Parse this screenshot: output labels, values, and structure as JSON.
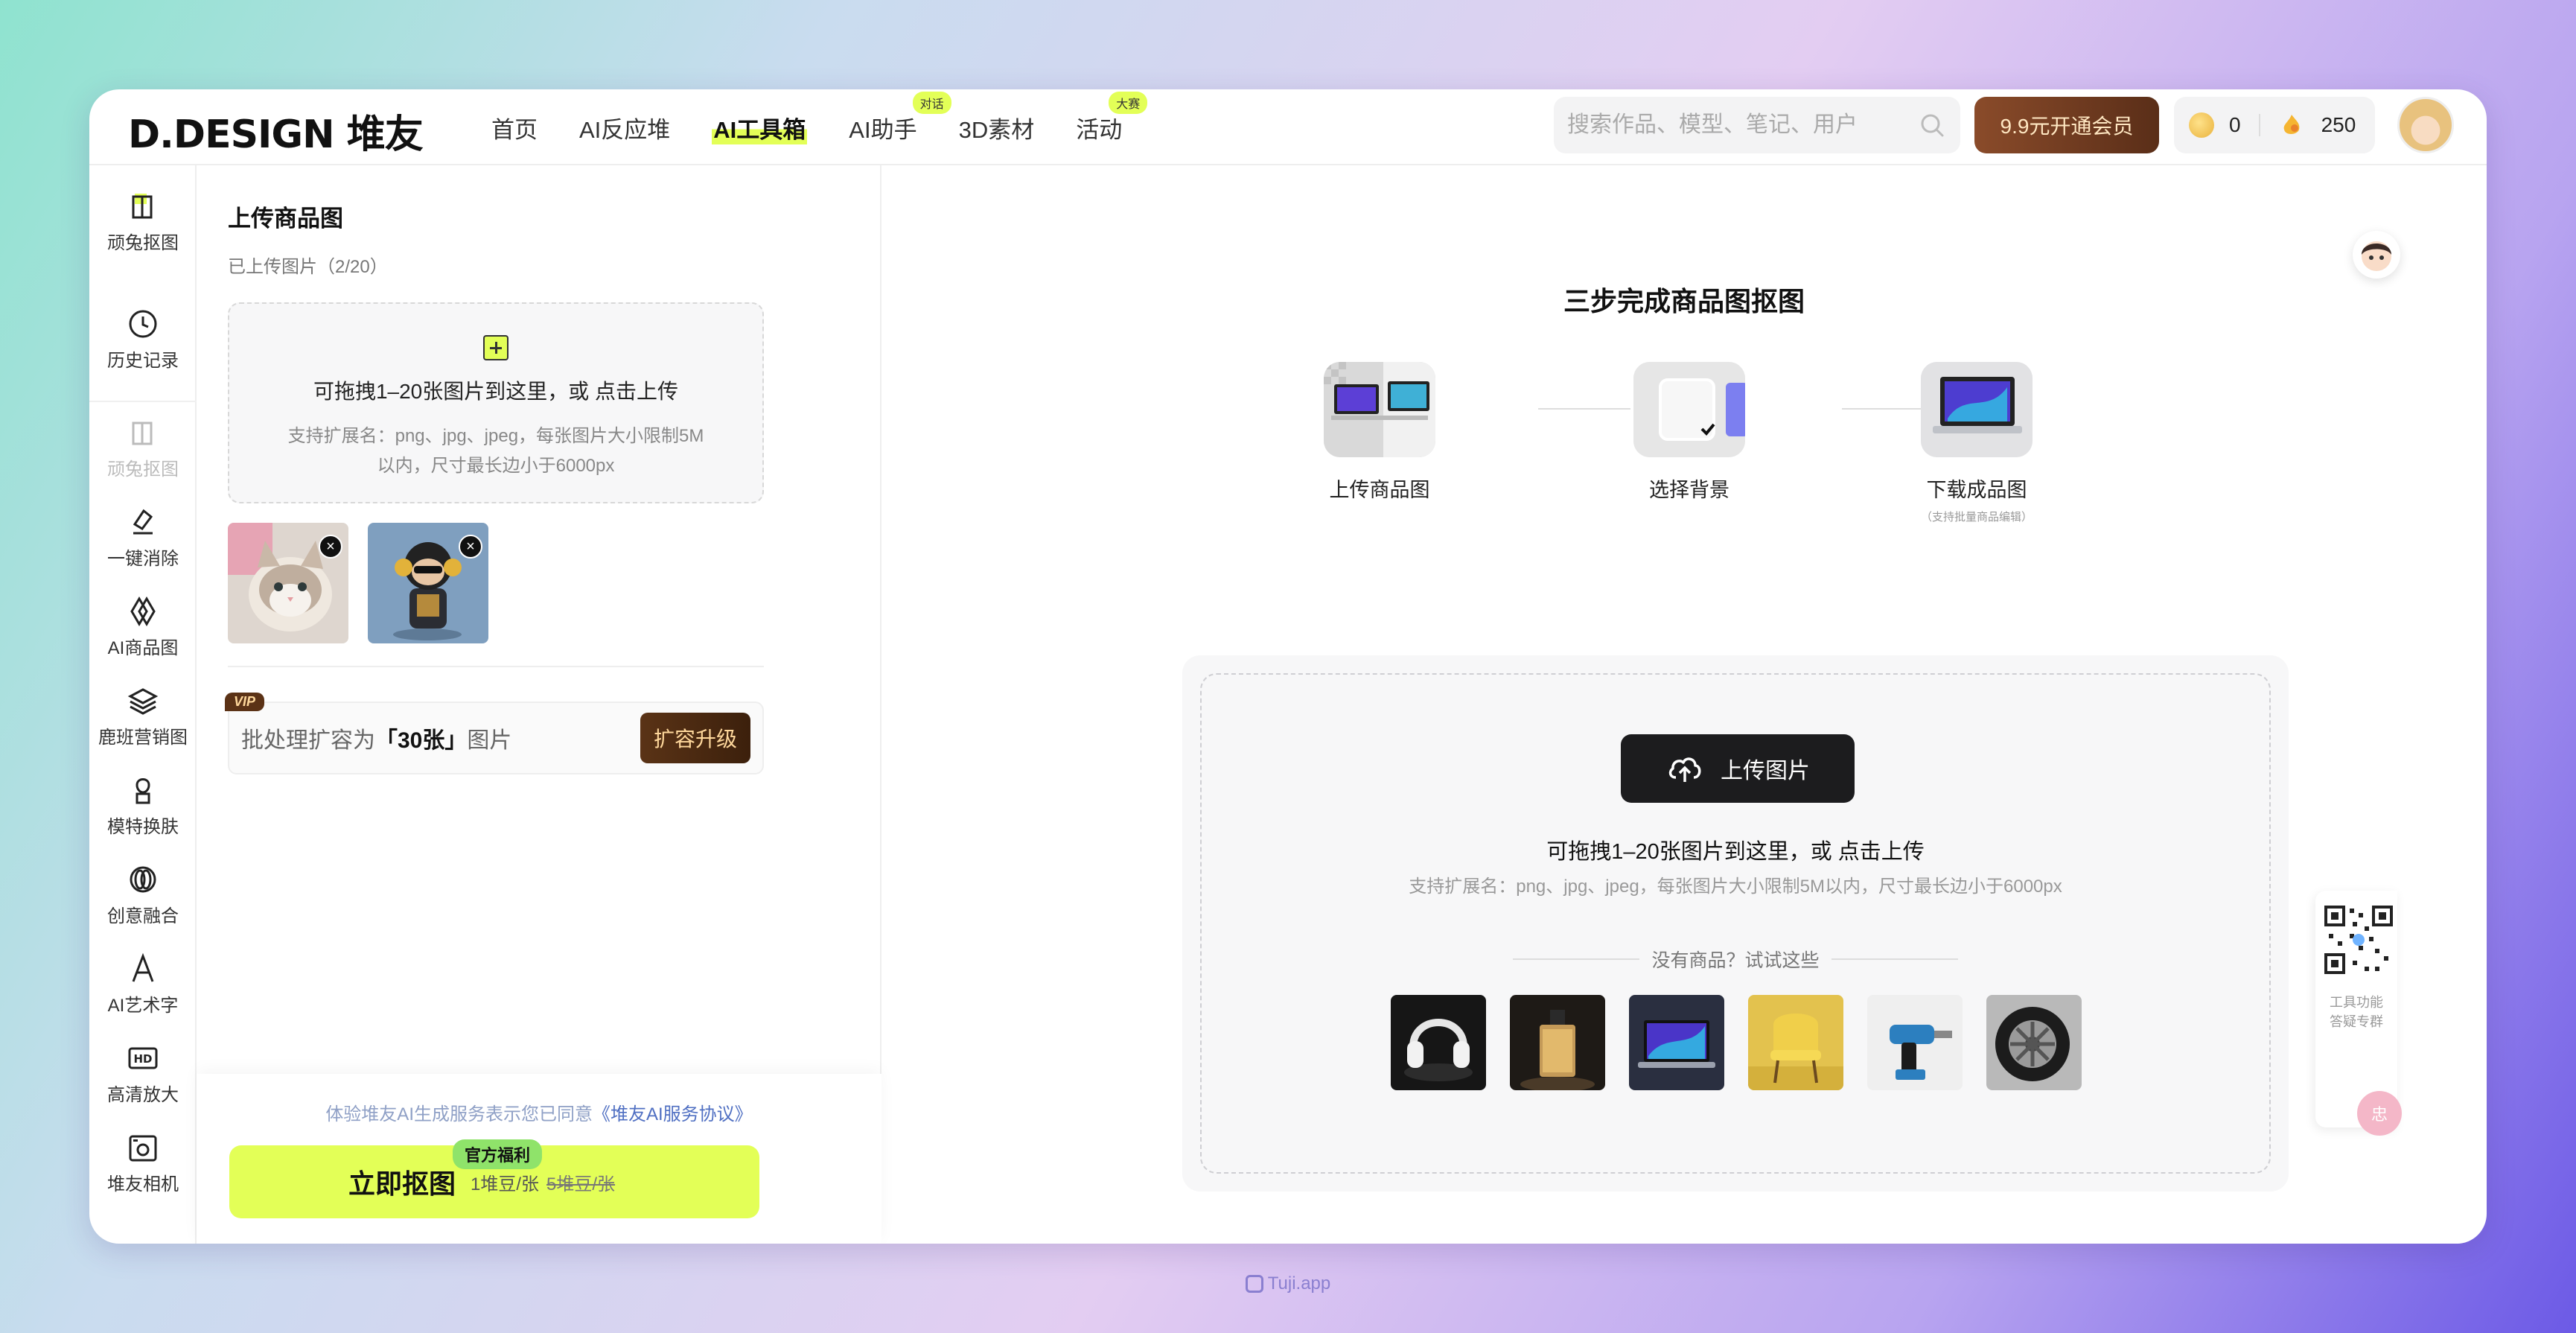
{
  "brand": {
    "logo": "D.DESIGN 堆友"
  },
  "nav": {
    "items": [
      {
        "label": "首页"
      },
      {
        "label": "AI反应堆"
      },
      {
        "label": "AI工具箱"
      },
      {
        "label": "AI助手",
        "badge": "对话"
      },
      {
        "label": "3D素材"
      },
      {
        "label": "活动",
        "badge": "大赛"
      }
    ],
    "search_placeholder": "搜索作品、模型、笔记、用户",
    "vip_button": "9.9元开通会员",
    "coins": "0",
    "beans": "250"
  },
  "rail": {
    "items": [
      {
        "label": "顽兔抠图",
        "icon": "cutout-icon"
      },
      {
        "label": "历史记录",
        "icon": "clock-icon"
      },
      {
        "label": "顽兔抠图",
        "icon": "cutout-icon"
      },
      {
        "label": "一键消除",
        "icon": "eraser-icon"
      },
      {
        "label": "AI商品图",
        "icon": "ai-product-icon"
      },
      {
        "label": "鹿班营销图",
        "icon": "layers-icon"
      },
      {
        "label": "模特换肤",
        "icon": "model-icon"
      },
      {
        "label": "创意融合",
        "icon": "fusion-icon"
      },
      {
        "label": "AI艺术字",
        "icon": "art-text-icon"
      },
      {
        "label": "高清放大",
        "icon": "hd-icon"
      },
      {
        "label": "堆友相机",
        "icon": "camera-icon"
      }
    ]
  },
  "left_panel": {
    "title": "上传商品图",
    "uploaded": "已上传图片（2/20）",
    "dropzone_main": "可拖拽1–20张图片到这里，或 点击上传",
    "dropzone_hint": "支持扩展名：png、jpg、jpeg，每张图片大小限制5M以内，尺寸最长边小于6000px",
    "upgrade": {
      "vip_tag": "VIP",
      "text_prefix": "批处理扩容为",
      "text_bold": "「30张」",
      "text_suffix": "图片",
      "button": "扩容升级"
    },
    "footer": {
      "agree_text": "体验堆友AI生成服务表示您已同意",
      "agree_link": "《堆友AI服务协议》",
      "go_button": "立即抠图",
      "price": "1堆豆/张",
      "old_price": "5堆豆/张",
      "perk_badge": "官方福利"
    }
  },
  "main": {
    "steps_title": "三步完成商品图抠图",
    "steps": [
      {
        "label": "上传商品图",
        "note": ""
      },
      {
        "label": "选择背景",
        "note": ""
      },
      {
        "label": "下载成品图",
        "note": "（支持批量商品编辑）"
      }
    ],
    "upload_button": "上传图片",
    "upload_main": "可拖拽1–20张图片到这里，或 点击上传",
    "upload_hint": "支持扩展名：png、jpg、jpeg，每张图片大小限制5M以内，尺寸最长边小于6000px",
    "try_text": "没有商品？试试这些",
    "samples": [
      "耳机",
      "香水",
      "笔记本电脑",
      "椅子",
      "电钻",
      "轮胎"
    ]
  },
  "side": {
    "qr_text_1": "工具功能",
    "qr_text_2": "答疑专群",
    "chat_fab": "忠"
  },
  "watermark": "Tuji.app"
}
